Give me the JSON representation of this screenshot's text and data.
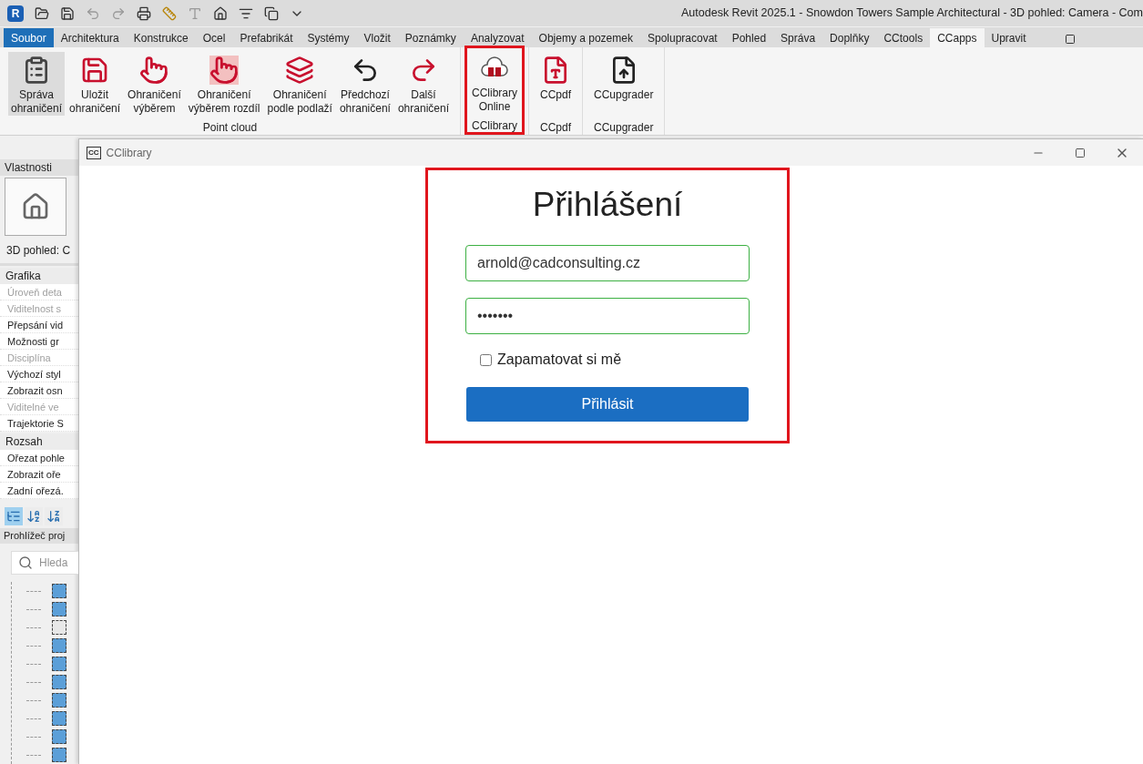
{
  "app": {
    "logo": "R",
    "title": "Autodesk Revit 2025.1 - Snowdon Towers Sample Architectural - 3D pohled: Camera - Com"
  },
  "tabs": [
    {
      "label": "Soubor",
      "kind": "file",
      "selected": false
    },
    {
      "label": "Architektura",
      "kind": "tab",
      "selected": false
    },
    {
      "label": "Konstrukce",
      "kind": "tab",
      "selected": false
    },
    {
      "label": "Ocel",
      "kind": "tab",
      "selected": false
    },
    {
      "label": "Prefabrikát",
      "kind": "tab",
      "selected": false
    },
    {
      "label": "Systémy",
      "kind": "tab",
      "selected": false
    },
    {
      "label": "Vložit",
      "kind": "tab",
      "selected": false
    },
    {
      "label": "Poznámky",
      "kind": "tab",
      "selected": false
    },
    {
      "label": "Analyzovat",
      "kind": "tab",
      "selected": false
    },
    {
      "label": "Objemy a pozemek",
      "kind": "tab",
      "selected": false
    },
    {
      "label": "Spolupracovat",
      "kind": "tab",
      "selected": false
    },
    {
      "label": "Pohled",
      "kind": "tab",
      "selected": false
    },
    {
      "label": "Správa",
      "kind": "tab",
      "selected": false
    },
    {
      "label": "Doplňky",
      "kind": "tab",
      "selected": false
    },
    {
      "label": "CCtools",
      "kind": "tab",
      "selected": false
    },
    {
      "label": "CCapps",
      "kind": "tab",
      "selected": true
    },
    {
      "label": "Upravit",
      "kind": "tab",
      "selected": false
    }
  ],
  "ribbon": {
    "panels": [
      {
        "title": "Point cloud",
        "highlighted": false,
        "buttons": [
          {
            "label": [
              "Správa",
              "ohraničení"
            ],
            "kind": "clipboard",
            "selected": true
          },
          {
            "label": [
              "Uložit",
              "ohraničení"
            ],
            "kind": "save",
            "selected": false
          },
          {
            "label": [
              "Ohraničení",
              "výběrem"
            ],
            "kind": "pick",
            "selected": false
          },
          {
            "label": [
              "Ohraničení",
              "výběrem rozdíl"
            ],
            "kind": "pickdiff",
            "selected": false
          },
          {
            "label": [
              "Ohraničení",
              "podle podlaží"
            ],
            "kind": "levels",
            "selected": false
          },
          {
            "label": [
              "Předchozí",
              "ohraničení"
            ],
            "kind": "undo",
            "selected": false
          },
          {
            "label": [
              "Další",
              "ohraničení"
            ],
            "kind": "redo",
            "selected": false
          }
        ]
      },
      {
        "title": "CClibrary",
        "highlighted": true,
        "buttons": [
          {
            "label": [
              "CClibrary",
              "Online"
            ],
            "kind": "library",
            "selected": false
          }
        ]
      },
      {
        "title": "CCpdf",
        "highlighted": false,
        "buttons": [
          {
            "label": [
              "CCpdf"
            ],
            "kind": "pdf",
            "selected": false
          }
        ]
      },
      {
        "title": "CCupgrader",
        "highlighted": false,
        "buttons": [
          {
            "label": [
              "CCupgrader"
            ],
            "kind": "upgrade",
            "selected": false
          }
        ]
      }
    ]
  },
  "properties": {
    "title": "Vlastnosti",
    "view_type": "3D pohled: C",
    "groups": [
      {
        "title": "Grafika",
        "rows": [
          {
            "label": "Úroveň deta",
            "disabled": true
          },
          {
            "label": "Viditelnost s",
            "disabled": true
          },
          {
            "label": "Přepsání vid",
            "disabled": false
          },
          {
            "label": "Možnosti gr",
            "disabled": false
          },
          {
            "label": "Disciplína",
            "disabled": true
          },
          {
            "label": "Výchozí styl",
            "disabled": false
          },
          {
            "label": "Zobrazit osn",
            "disabled": false
          },
          {
            "label": "Viditelné ve",
            "disabled": true
          },
          {
            "label": "Trajektorie S",
            "disabled": false
          }
        ]
      },
      {
        "title": "Rozsah",
        "rows": [
          {
            "label": "Ořezat pohle",
            "disabled": false
          },
          {
            "label": "Zobrazit oře",
            "disabled": false
          },
          {
            "label": "Zadní ořezá.",
            "disabled": false
          }
        ]
      }
    ],
    "sort_buttons": [
      {
        "kind": "category",
        "selected": true
      },
      {
        "kind": "az",
        "selected": false
      },
      {
        "kind": "za",
        "selected": false
      }
    ]
  },
  "browser": {
    "title": "Prohlížeč proj",
    "search_placeholder": "Hleda",
    "items": [
      {
        "filled": true
      },
      {
        "filled": true
      },
      {
        "filled": false
      },
      {
        "filled": true
      },
      {
        "filled": true
      },
      {
        "filled": true
      },
      {
        "filled": true
      },
      {
        "filled": true
      },
      {
        "filled": true
      },
      {
        "filled": true
      }
    ]
  },
  "dialog": {
    "icon": "CC",
    "title": "CClibrary",
    "highlighted": true,
    "heading": "Přihlášení",
    "email": "arnold@cadconsulting.cz",
    "password": "•••••••",
    "remember": {
      "label": "Zapamatovat si mě",
      "checked": false
    },
    "submit": "Přihlásit"
  }
}
